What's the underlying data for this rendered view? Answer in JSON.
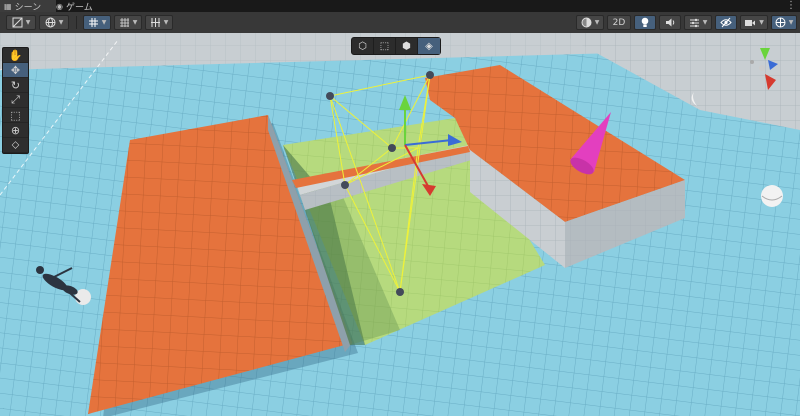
{
  "tabs": [
    {
      "label": "シーン",
      "icon": "grid-icon",
      "active": true
    },
    {
      "label": "ゲーム",
      "icon": "gamepad-icon",
      "active": false
    }
  ],
  "window_menu": "⋮",
  "toolbar": {
    "draw_mode_icon": "square-slash-icon",
    "global_icon": "globe-icon",
    "grid_icon": "grid-snap-icon",
    "snap_icon": "snap-icon",
    "increment_icon": "increment-snap-icon",
    "shading_icon": "shading-sphere-icon",
    "two_d_label": "2D",
    "lighting_icon": "lightbulb-icon",
    "audio_icon": "speaker-icon",
    "effects_icon": "effects-icon",
    "visibility_icon": "eye-slash-icon",
    "camera_icon": "camera-icon",
    "gizmos_icon": "gizmo-globe-icon"
  },
  "tools": [
    {
      "name": "hand-tool",
      "glyph": "✋",
      "active": false
    },
    {
      "name": "move-tool",
      "glyph": "✥",
      "active": true
    },
    {
      "name": "rotate-tool",
      "glyph": "↻",
      "active": false
    },
    {
      "name": "scale-tool",
      "glyph": "⤢",
      "active": false
    },
    {
      "name": "rect-tool",
      "glyph": "⬚",
      "active": false
    },
    {
      "name": "transform-tool",
      "glyph": "⊕",
      "active": false
    },
    {
      "name": "custom-tool",
      "glyph": "⬦",
      "active": false
    }
  ],
  "draw_modes": [
    {
      "name": "box-mode",
      "glyph": "⬡",
      "active": false
    },
    {
      "name": "rect-mode",
      "glyph": "⬚",
      "active": false
    },
    {
      "name": "cube-mode",
      "glyph": "⬢",
      "active": false
    },
    {
      "name": "solid-mode",
      "glyph": "◈",
      "active": true
    }
  ],
  "colors": {
    "orange": "#e4733e",
    "ground": "#84c8dd",
    "wall": "#c9ced1",
    "green": "#b8de7c",
    "magenta": "#e33fbf",
    "accent": "#46607c",
    "gizmo_x": "#d63a2f",
    "gizmo_y": "#6ad43c",
    "gizmo_z": "#3a6cd6"
  }
}
